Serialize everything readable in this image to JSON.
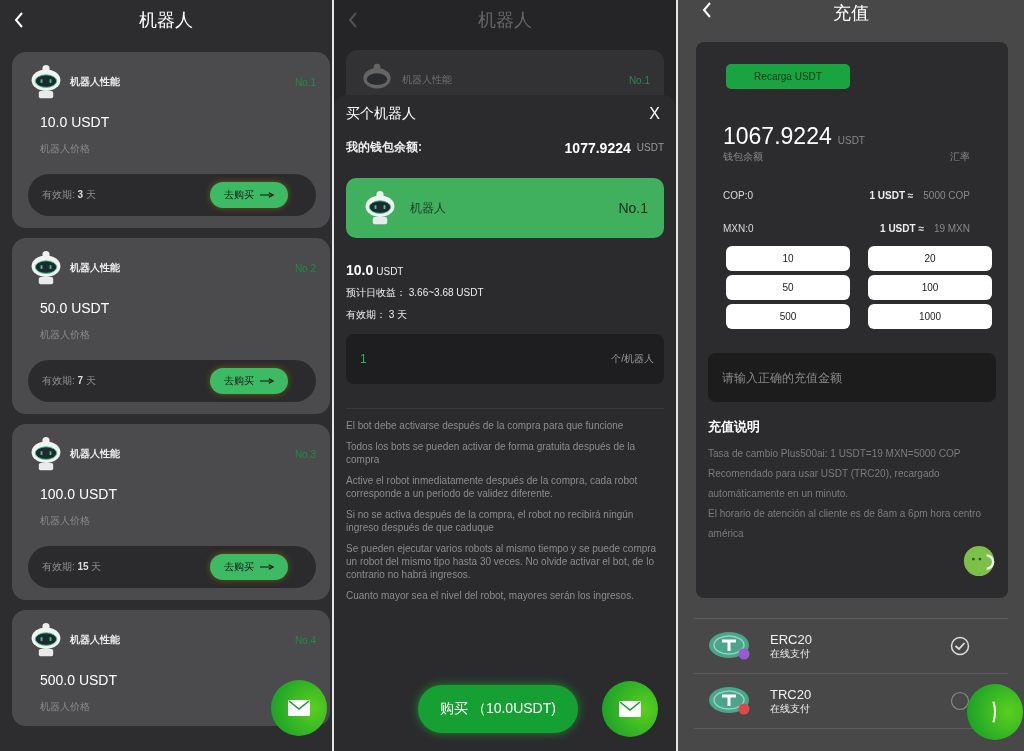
{
  "robot_list": {
    "title": "机器人",
    "cards": [
      {
        "name": "机器人性能",
        "number": "No.1",
        "price": "10.0 USDT",
        "price_label": "机器人价格",
        "validity_label": "有效期:",
        "validity_days": "3",
        "validity_unit": "天",
        "buy": "去购买"
      },
      {
        "name": "机器人性能",
        "number": "No.2",
        "price": "50.0 USDT",
        "price_label": "机器人价格",
        "validity_label": "有效期:",
        "validity_days": "7",
        "validity_unit": "天",
        "buy": "去购买"
      },
      {
        "name": "机器人性能",
        "number": "No.3",
        "price": "100.0 USDT",
        "price_label": "机器人价格",
        "validity_label": "有效期:",
        "validity_days": "15",
        "validity_unit": "天",
        "buy": "去购买"
      },
      {
        "name": "机器人性能",
        "number": "No.4",
        "price": "500.0 USDT",
        "price_label": "机器人价格"
      }
    ]
  },
  "purchase": {
    "background_title": "机器人",
    "background_card": {
      "name": "机器人性能",
      "number": "No.1"
    },
    "sheet_title": "买个机器人",
    "close": "X",
    "balance_label": "我的钱包余额:",
    "balance": "1077.9224",
    "balance_unit": "USDT",
    "robot_name": "机器人",
    "robot_number": "No.1",
    "price": "10.0",
    "price_unit": "USDT",
    "daily_income": "预计日收益： 3.66~3.68 USDT",
    "validity": "有效期： 3 天",
    "quantity": {
      "value": "1",
      "unit": "个/机器人"
    },
    "notes": [
      "El bot debe activarse después de la compra para que funcione",
      "Todos los bots se pueden activar de forma gratuita después de la compra",
      "Active el robot inmediatamente después de la compra, cada robot corresponde a un período de validez diferente.",
      "Si no se activa después de la compra, el robot no recibirá ningún ingreso después de que caduque",
      "Se pueden ejecutar varios robots al mismo tiempo y se puede compra un robot del mismo tipo hasta 30 veces. No olvide activar el bot, de lo contrario no habrá ingresos.",
      "Cuanto mayor sea el nivel del robot, mayores serán los ingresos."
    ],
    "buy_button": "购买 （10.0USDT)"
  },
  "recharge": {
    "title": "充值",
    "tab": "Recarga USDT",
    "balance": "1067.9224",
    "balance_unit": "USDT",
    "balance_label": "钱包余额",
    "rate_label": "汇率",
    "currencies": [
      {
        "name": "COP:0",
        "rate": "1 USDT ≈",
        "value": "5000 COP"
      },
      {
        "name": "MXN:0",
        "rate": "1 USDT ≈",
        "value": "19 MXN"
      }
    ],
    "amounts": [
      "10",
      "20",
      "50",
      "100",
      "500",
      "1000"
    ],
    "amount_placeholder": "请输入正确的充值金额",
    "instructions_title": "充值说明",
    "instructions": [
      "Tasa de cambio Plus500ai: 1 USDT=19 MXN=5000 COP",
      "Recomendado para usar USDT (TRC20), recargado automáticamente en un minuto.",
      "El horario de atención al cliente es de 8am a 6pm hora centro américa"
    ],
    "methods": [
      {
        "name": "ERC20",
        "subtitle": "在线支付",
        "selected": true,
        "color": "#9b59d6"
      },
      {
        "name": "TRC20",
        "subtitle": "在线支付",
        "selected": false,
        "color": "#e04848"
      }
    ]
  }
}
